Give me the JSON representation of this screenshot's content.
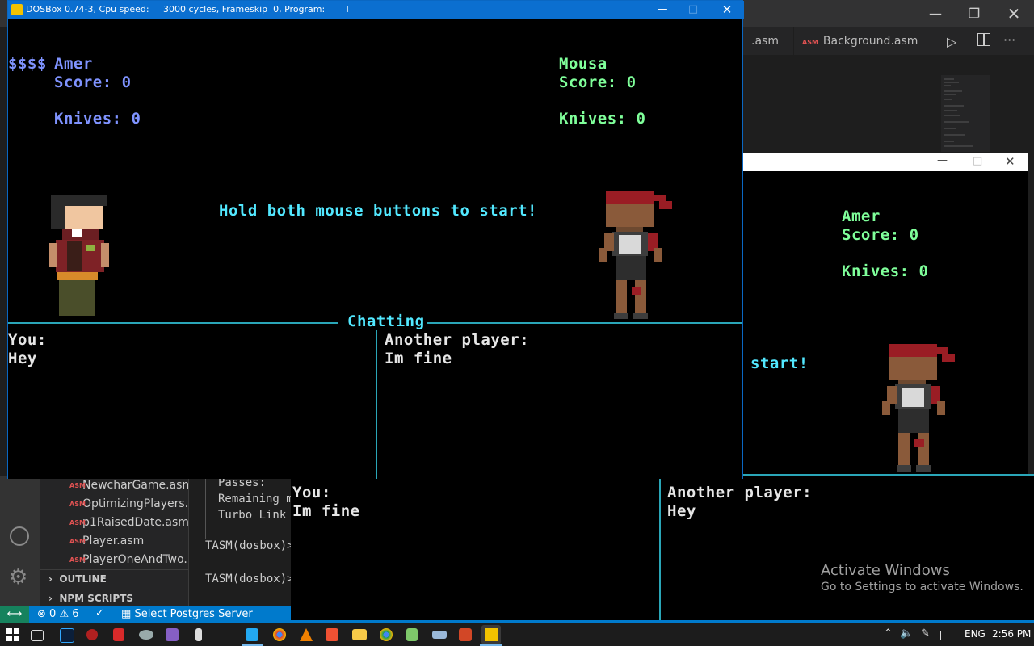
{
  "vscode": {
    "tabs": [
      {
        "label": ".asm",
        "icon": "asm-file-icon",
        "badge": "ASM"
      },
      {
        "label": "Background.asm",
        "icon": "asm-file-icon",
        "badge": "ASM"
      }
    ],
    "explorer_files": [
      {
        "name": "NewcharGame.asm",
        "badge": "ASM"
      },
      {
        "name": "OptimizingPlayers....",
        "badge": "ASM"
      },
      {
        "name": "p1RaisedDate.asm",
        "badge": "ASM"
      },
      {
        "name": "Player.asm",
        "badge": "ASM"
      },
      {
        "name": "PlayerOneAndTwo...",
        "badge": "ASM"
      }
    ],
    "sections": [
      {
        "label": "OUTLINE",
        "icon": "chevron-right-icon"
      },
      {
        "label": "NPM SCRIPTS",
        "icon": "chevron-right-icon"
      }
    ],
    "terminal_lines": [
      "Passes:",
      "Remaining m",
      "Turbo Link",
      "",
      "TASM(dosbox)>",
      "",
      "TASM(dosbox)>"
    ],
    "statusbar": {
      "errors": "0",
      "warnings": "6",
      "postgres": "Select Postgres Server"
    }
  },
  "dosbox_main": {
    "title": "DOSBox 0.74-3, Cpu speed:     3000 cycles, Frameskip  0, Program:       T",
    "currency": "$$$$",
    "player1": {
      "name": "Amer",
      "score": "Score: 0",
      "knives": "Knives: 0"
    },
    "player2": {
      "name": "Mousa",
      "score": "Score: 0",
      "knives": "Knives: 0"
    },
    "prompt": "Hold both mouse buttons to start!",
    "chat_title": "Chatting",
    "chat_you_label": "You:",
    "chat_you_text": "Hey",
    "chat_other_label": "Another player:",
    "chat_other_text": "Im fine",
    "colors": {
      "player1": "#7f93ff",
      "player2": "#7fff9a",
      "accent": "#52e8ff",
      "divider": "#2aa6b8"
    }
  },
  "dosbox_second": {
    "player1": {
      "name": "Amer",
      "score": "Score: 0",
      "knives": "Knives: 0"
    },
    "prompt_fragment": "start!",
    "chat_you_label": "You:",
    "chat_you_text": "Im fine",
    "chat_other_label": "Another player:",
    "chat_other_text": "Hey"
  },
  "watermark": {
    "title": "Activate Windows",
    "subtitle": "Go to Settings to activate Windows."
  },
  "taskbar": {
    "language": "ENG",
    "time": "2:56 PM",
    "apps": [
      "windows-start-icon",
      "task-view-icon",
      "photoshop-icon",
      "app-red-icon",
      "app-shield-icon",
      "app-cloud-icon",
      "visual-studio-icon",
      "app-mic-icon",
      "vscode-icon",
      "chrome-icon",
      "vlc-icon",
      "git-icon",
      "file-explorer-icon",
      "chrome-icon",
      "notepad-icon",
      "app-boat-icon",
      "powerpoint-icon",
      "dosbox-icon"
    ]
  }
}
